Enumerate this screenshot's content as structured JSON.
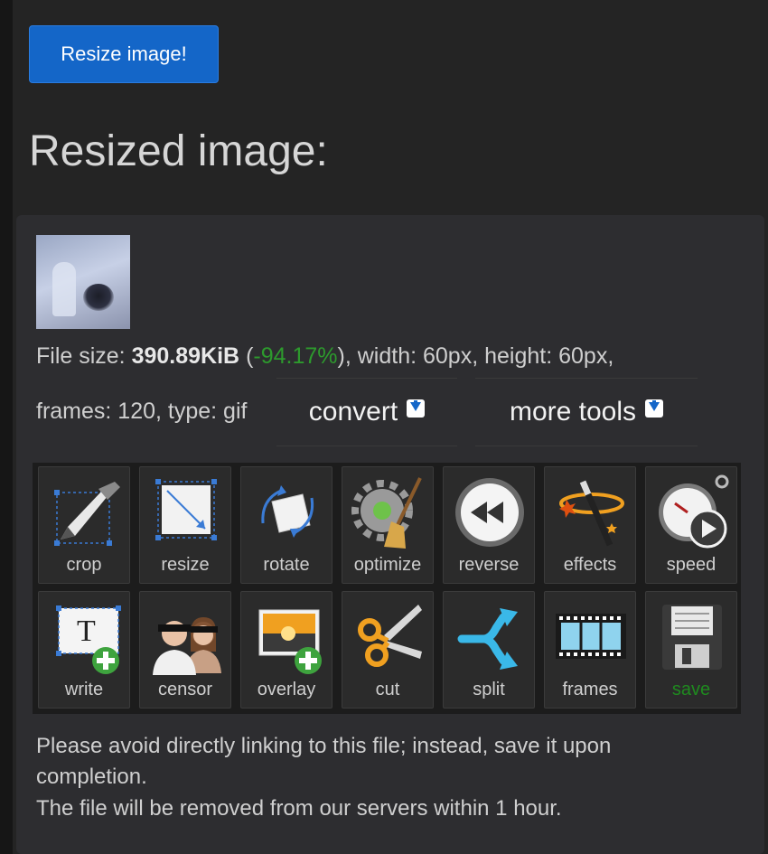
{
  "resize_button": {
    "label": "Resize image!"
  },
  "heading": "Resized image:",
  "file_info": {
    "prefix": "File size: ",
    "size": "390.89KiB",
    "paren_open": " (",
    "change": "-94.17%",
    "rest": "), width: 60px, height: 60px,",
    "line2": "frames: 120, type: gif"
  },
  "dropdowns": {
    "convert": "convert",
    "more_tools": "more tools"
  },
  "tools": [
    {
      "label": "crop",
      "icon": "crop-icon"
    },
    {
      "label": "resize",
      "icon": "resize-icon"
    },
    {
      "label": "rotate",
      "icon": "rotate-icon"
    },
    {
      "label": "optimize",
      "icon": "optimize-icon"
    },
    {
      "label": "reverse",
      "icon": "reverse-icon"
    },
    {
      "label": "effects",
      "icon": "effects-icon"
    },
    {
      "label": "speed",
      "icon": "speed-icon"
    },
    {
      "label": "write",
      "icon": "write-icon"
    },
    {
      "label": "censor",
      "icon": "censor-icon"
    },
    {
      "label": "overlay",
      "icon": "overlay-icon"
    },
    {
      "label": "cut",
      "icon": "cut-icon"
    },
    {
      "label": "split",
      "icon": "split-icon"
    },
    {
      "label": "frames",
      "icon": "frames-icon"
    },
    {
      "label": "save",
      "icon": "save-icon"
    }
  ],
  "notes": {
    "line1": "Please avoid directly linking to this file; instead, save it upon",
    "line2": "completion.",
    "line3": "The file will be removed from our servers within 1 hour."
  },
  "colors": {
    "accent": "#1466c8",
    "positive": "#2d9a2d",
    "background": "#242424"
  }
}
